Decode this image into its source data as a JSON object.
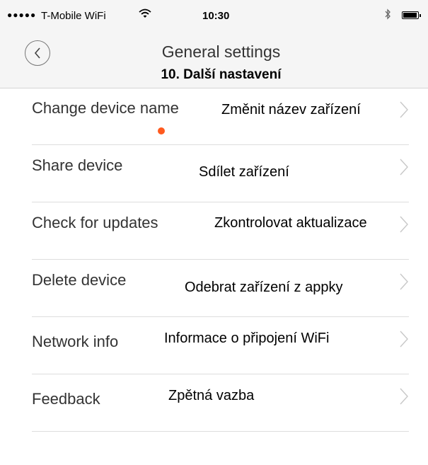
{
  "status_bar": {
    "signal": "●●●●●",
    "carrier": "T-Mobile WiFi",
    "wifi_icon": "wifi-icon",
    "time": "10:30",
    "bluetooth_icon": "bluetooth-icon",
    "battery_icon": "battery-icon",
    "battery_level": 0.95
  },
  "header": {
    "back_icon": "chevron-left-icon",
    "title": "General settings",
    "annotation": "10. Další nastavení"
  },
  "settings": {
    "items": [
      {
        "label": "Change device name",
        "annotation": "Změnit název zařízení"
      },
      {
        "label": "Share device",
        "annotation": "Sdílet zařízení"
      },
      {
        "label": "Check for updates",
        "annotation": "Zkontrolovat aktualizace",
        "has_update_dot": true
      },
      {
        "label": "Delete device",
        "annotation": "Odebrat zařízení z appky"
      },
      {
        "label": "Network info",
        "annotation": "Informace o připojení WiFi"
      },
      {
        "label": "Feedback",
        "annotation": "Zpětná vazba"
      }
    ]
  },
  "colors": {
    "header_bg": "#f5f5f5",
    "update_dot": "#ff5a1e",
    "divider": "#dddddd"
  }
}
